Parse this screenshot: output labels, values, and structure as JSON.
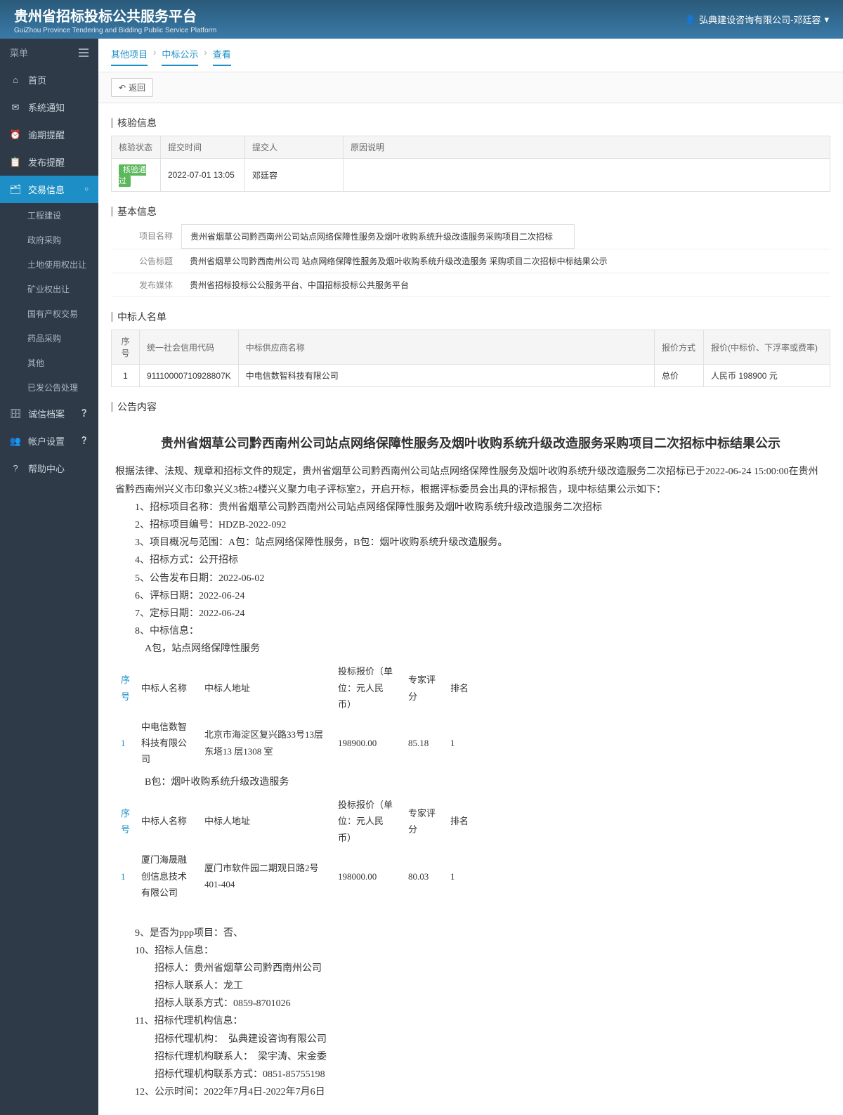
{
  "header": {
    "title": "贵州省招标投标公共服务平台",
    "subtitle": "GuiZhou Province Tendering and Bidding Public Service Platform",
    "user": "弘典建设咨询有限公司-邓廷容"
  },
  "sidebar": {
    "menu_label": "菜单",
    "items": [
      {
        "icon": "⌂",
        "label": "首页"
      },
      {
        "icon": "✉",
        "label": "系统通知"
      },
      {
        "icon": "⏰",
        "label": "逾期提醒"
      },
      {
        "icon": "📋",
        "label": "发布提醒"
      },
      {
        "icon": "🗂",
        "label": "交易信息",
        "active": true,
        "expand": "○"
      },
      {
        "icon": "🗄",
        "label": "诚信档案",
        "badge": "?"
      },
      {
        "icon": "👥",
        "label": "帐户设置",
        "badge": "?"
      },
      {
        "icon": "?",
        "label": "帮助中心"
      }
    ],
    "sub": [
      {
        "label": "工程建设"
      },
      {
        "label": "政府采购"
      },
      {
        "label": "土地使用权出让"
      },
      {
        "label": "矿业权出让"
      },
      {
        "label": "国有产权交易"
      },
      {
        "label": "药品采购"
      },
      {
        "label": "其他"
      },
      {
        "label": "已发公告处理"
      }
    ]
  },
  "breadcrumb": [
    "其他项目",
    "中标公示",
    "查看"
  ],
  "back_btn": "返回",
  "review": {
    "title": "核验信息",
    "headers": [
      "核验状态",
      "提交时间",
      "提交人",
      "原因说明"
    ],
    "status_badge": "核验通过",
    "submit_time": "2022-07-01 13:05",
    "submitter": "邓廷容",
    "reason": ""
  },
  "basic": {
    "title": "基本信息",
    "rows": [
      {
        "label": "项目名称",
        "value": "贵州省烟草公司黔西南州公司站点网络保障性服务及烟叶收购系统升级改造服务采购项目二次招标"
      },
      {
        "label": "公告标题",
        "value": "贵州省烟草公司黔西南州公司 站点网络保障性服务及烟叶收购系统升级改造服务 采购项目二次招标中标结果公示"
      },
      {
        "label": "发布媒体",
        "value": "贵州省招标投标公公服务平台、中国招标投标公共服务平台"
      }
    ]
  },
  "winners": {
    "title": "中标人名单",
    "headers": [
      "序号",
      "统一社会信用代码",
      "中标供应商名称",
      "报价方式",
      "报价(中标价、下浮率或费率)"
    ],
    "rows": [
      {
        "seq": "1",
        "code": "91110000710928807K",
        "name": "中电信数智科技有限公司",
        "method": "总价",
        "price": "人民币 198900 元"
      }
    ]
  },
  "announcement": {
    "title": "公告内容",
    "doc_title": "贵州省烟草公司黔西南州公司站点网络保障性服务及烟叶收购系统升级改造服务采购项目二次招标中标结果公示",
    "intro": "根据法律、法规、规章和招标文件的规定，贵州省烟草公司黔西南州公司站点网络保障性服务及烟叶收购系统升级改造服务二次招标已于2022-06-24 15:00:00在贵州省黔西南州兴义市印象兴义3栋24楼兴义聚力电子评标室2，开启开标，根据评标委员会出具的评标报告，现中标结果公示如下：",
    "items": [
      "1、招标项目名称：贵州省烟草公司黔西南州公司站点网络保障性服务及烟叶收购系统升级改造服务二次招标",
      "2、招标项目编号：HDZB-2022-092",
      "3、项目概况与范围：A包：站点网络保障性服务，B包：烟叶收购系统升级改造服务。",
      "4、招标方式：公开招标",
      "5、公告发布日期：2022-06-02",
      "6、评标日期：2022-06-24",
      "7、定标日期：2022-06-24",
      "8、中标信息："
    ],
    "pkg_a_title": "A包，站点网络保障性服务",
    "pkg_b_title": "B包：烟叶收购系统升级改造服务",
    "tbl_headers": [
      "序号",
      "中标人名称",
      "中标人地址",
      "投标报价（单位：元人民币）",
      "专家评分",
      "排名"
    ],
    "pkg_a_row": {
      "seq": "1",
      "name": "中电信数智科技有限公司",
      "addr": "北京市海淀区复兴路33号13层东塔13 层1308 室",
      "price": "198900.00",
      "score": "85.18",
      "rank": "1"
    },
    "pkg_b_row": {
      "seq": "1",
      "name": "厦门海晟融创信息技术有限公司",
      "addr": "厦门市软件园二期观日路2号401-404",
      "price": "198000.00",
      "score": "80.03",
      "rank": "1"
    },
    "tail": [
      "9、是否为ppp项目：否、",
      "10、招标人信息：",
      "　　招标人：贵州省烟草公司黔西南州公司",
      "　　招标人联系人：龙工",
      "　　招标人联系方式：0859-8701026",
      "11、招标代理机构信息：",
      "　　招标代理机构：　弘典建设咨询有限公司",
      "　　招标代理机构联系人：　梁宇涛、宋金委",
      "　　招标代理机构联系方式：0851-85755198",
      "12、公示时间：2022年7月4日-2022年7月6日"
    ]
  }
}
